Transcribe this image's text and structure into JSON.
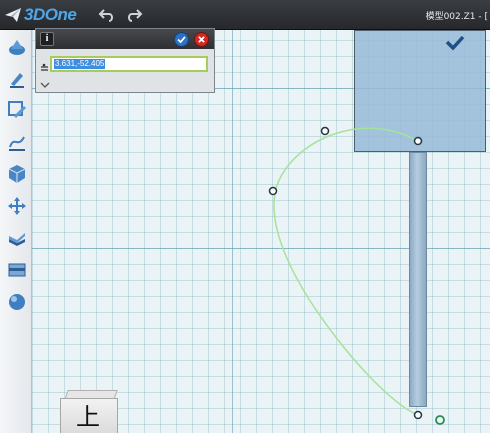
{
  "app": {
    "logo_text": "3DOne",
    "window_title": "模型002.Z1 - [",
    "toolbar": [
      {
        "name": "undo",
        "icon": "undo-icon"
      },
      {
        "name": "redo",
        "icon": "redo-icon"
      }
    ]
  },
  "sidebar": {
    "items": [
      {
        "name": "basic-shapes",
        "icon": "basic-shapes-icon"
      },
      {
        "name": "sketch",
        "icon": "pencil-icon"
      },
      {
        "name": "sketch-edit",
        "icon": "sketch-edit-icon"
      },
      {
        "name": "curve",
        "icon": "curve-icon"
      },
      {
        "name": "feature",
        "icon": "cube-icon"
      },
      {
        "name": "move",
        "icon": "move-arrows-icon"
      },
      {
        "name": "combine",
        "icon": "combine-icon"
      },
      {
        "name": "panel",
        "icon": "panel-icon"
      },
      {
        "name": "material",
        "icon": "sphere-icon"
      }
    ]
  },
  "dialog": {
    "input_value": "3.631,-52.405",
    "info_label": "i"
  },
  "viewport": {
    "view_cube_label": "上"
  },
  "colors": {
    "accent": "#4fa6e8",
    "ok": "#2c6fc6",
    "cancel": "#cf2a22",
    "field_border": "#a8cc5a",
    "curve": "#a6e29a"
  }
}
